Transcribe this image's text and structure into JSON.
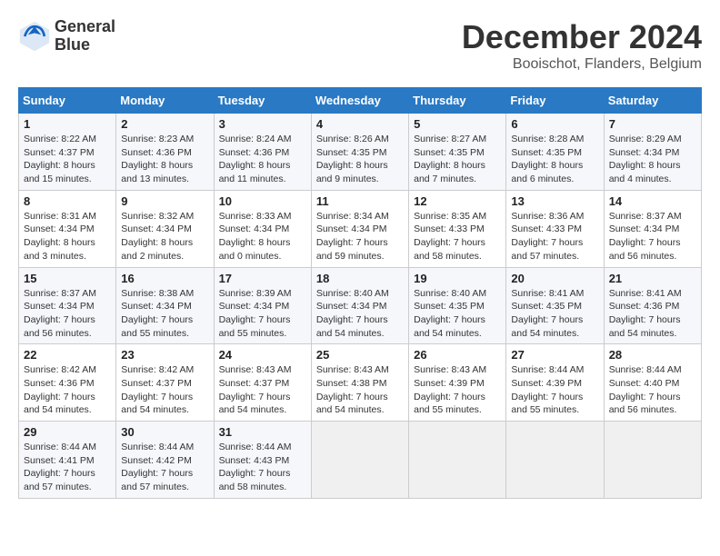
{
  "header": {
    "logo_line1": "General",
    "logo_line2": "Blue",
    "month": "December 2024",
    "location": "Booischot, Flanders, Belgium"
  },
  "weekdays": [
    "Sunday",
    "Monday",
    "Tuesday",
    "Wednesday",
    "Thursday",
    "Friday",
    "Saturday"
  ],
  "weeks": [
    [
      {
        "day": "1",
        "info": "Sunrise: 8:22 AM\nSunset: 4:37 PM\nDaylight: 8 hours\nand 15 minutes."
      },
      {
        "day": "2",
        "info": "Sunrise: 8:23 AM\nSunset: 4:36 PM\nDaylight: 8 hours\nand 13 minutes."
      },
      {
        "day": "3",
        "info": "Sunrise: 8:24 AM\nSunset: 4:36 PM\nDaylight: 8 hours\nand 11 minutes."
      },
      {
        "day": "4",
        "info": "Sunrise: 8:26 AM\nSunset: 4:35 PM\nDaylight: 8 hours\nand 9 minutes."
      },
      {
        "day": "5",
        "info": "Sunrise: 8:27 AM\nSunset: 4:35 PM\nDaylight: 8 hours\nand 7 minutes."
      },
      {
        "day": "6",
        "info": "Sunrise: 8:28 AM\nSunset: 4:35 PM\nDaylight: 8 hours\nand 6 minutes."
      },
      {
        "day": "7",
        "info": "Sunrise: 8:29 AM\nSunset: 4:34 PM\nDaylight: 8 hours\nand 4 minutes."
      }
    ],
    [
      {
        "day": "8",
        "info": "Sunrise: 8:31 AM\nSunset: 4:34 PM\nDaylight: 8 hours\nand 3 minutes."
      },
      {
        "day": "9",
        "info": "Sunrise: 8:32 AM\nSunset: 4:34 PM\nDaylight: 8 hours\nand 2 minutes."
      },
      {
        "day": "10",
        "info": "Sunrise: 8:33 AM\nSunset: 4:34 PM\nDaylight: 8 hours\nand 0 minutes."
      },
      {
        "day": "11",
        "info": "Sunrise: 8:34 AM\nSunset: 4:34 PM\nDaylight: 7 hours\nand 59 minutes."
      },
      {
        "day": "12",
        "info": "Sunrise: 8:35 AM\nSunset: 4:33 PM\nDaylight: 7 hours\nand 58 minutes."
      },
      {
        "day": "13",
        "info": "Sunrise: 8:36 AM\nSunset: 4:33 PM\nDaylight: 7 hours\nand 57 minutes."
      },
      {
        "day": "14",
        "info": "Sunrise: 8:37 AM\nSunset: 4:34 PM\nDaylight: 7 hours\nand 56 minutes."
      }
    ],
    [
      {
        "day": "15",
        "info": "Sunrise: 8:37 AM\nSunset: 4:34 PM\nDaylight: 7 hours\nand 56 minutes."
      },
      {
        "day": "16",
        "info": "Sunrise: 8:38 AM\nSunset: 4:34 PM\nDaylight: 7 hours\nand 55 minutes."
      },
      {
        "day": "17",
        "info": "Sunrise: 8:39 AM\nSunset: 4:34 PM\nDaylight: 7 hours\nand 55 minutes."
      },
      {
        "day": "18",
        "info": "Sunrise: 8:40 AM\nSunset: 4:34 PM\nDaylight: 7 hours\nand 54 minutes."
      },
      {
        "day": "19",
        "info": "Sunrise: 8:40 AM\nSunset: 4:35 PM\nDaylight: 7 hours\nand 54 minutes."
      },
      {
        "day": "20",
        "info": "Sunrise: 8:41 AM\nSunset: 4:35 PM\nDaylight: 7 hours\nand 54 minutes."
      },
      {
        "day": "21",
        "info": "Sunrise: 8:41 AM\nSunset: 4:36 PM\nDaylight: 7 hours\nand 54 minutes."
      }
    ],
    [
      {
        "day": "22",
        "info": "Sunrise: 8:42 AM\nSunset: 4:36 PM\nDaylight: 7 hours\nand 54 minutes."
      },
      {
        "day": "23",
        "info": "Sunrise: 8:42 AM\nSunset: 4:37 PM\nDaylight: 7 hours\nand 54 minutes."
      },
      {
        "day": "24",
        "info": "Sunrise: 8:43 AM\nSunset: 4:37 PM\nDaylight: 7 hours\nand 54 minutes."
      },
      {
        "day": "25",
        "info": "Sunrise: 8:43 AM\nSunset: 4:38 PM\nDaylight: 7 hours\nand 54 minutes."
      },
      {
        "day": "26",
        "info": "Sunrise: 8:43 AM\nSunset: 4:39 PM\nDaylight: 7 hours\nand 55 minutes."
      },
      {
        "day": "27",
        "info": "Sunrise: 8:44 AM\nSunset: 4:39 PM\nDaylight: 7 hours\nand 55 minutes."
      },
      {
        "day": "28",
        "info": "Sunrise: 8:44 AM\nSunset: 4:40 PM\nDaylight: 7 hours\nand 56 minutes."
      }
    ],
    [
      {
        "day": "29",
        "info": "Sunrise: 8:44 AM\nSunset: 4:41 PM\nDaylight: 7 hours\nand 57 minutes."
      },
      {
        "day": "30",
        "info": "Sunrise: 8:44 AM\nSunset: 4:42 PM\nDaylight: 7 hours\nand 57 minutes."
      },
      {
        "day": "31",
        "info": "Sunrise: 8:44 AM\nSunset: 4:43 PM\nDaylight: 7 hours\nand 58 minutes."
      },
      {
        "day": "",
        "info": ""
      },
      {
        "day": "",
        "info": ""
      },
      {
        "day": "",
        "info": ""
      },
      {
        "day": "",
        "info": ""
      }
    ]
  ]
}
